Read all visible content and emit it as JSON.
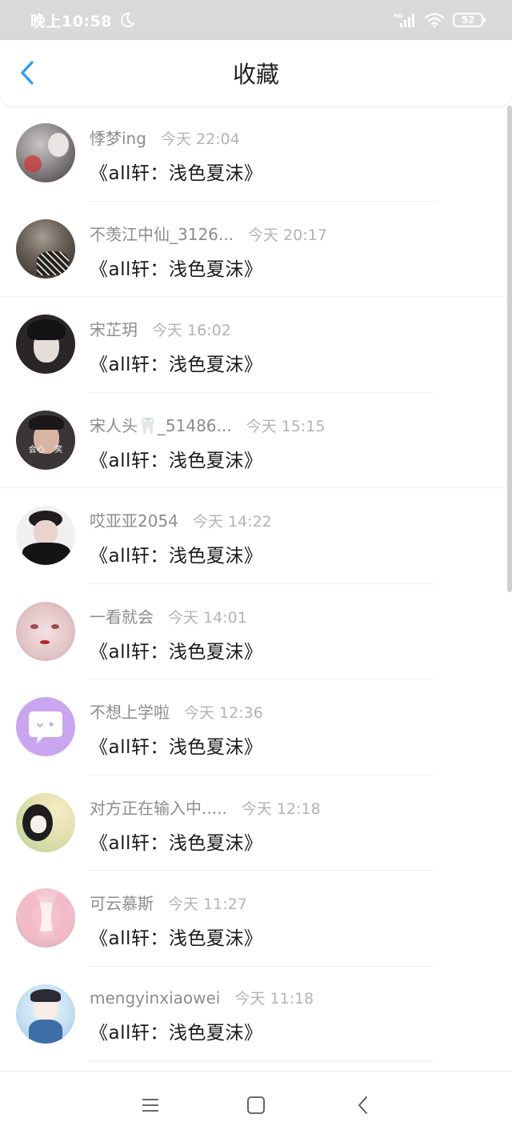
{
  "status_bar": {
    "time": "晚上10:58",
    "network": "HD",
    "battery": "52"
  },
  "header": {
    "title": "收藏"
  },
  "items": [
    {
      "name": "悸梦ing",
      "time": "今天 22:04",
      "title": "《all轩：浅色夏沫》"
    },
    {
      "name": "不羡江中仙_3126...",
      "time": "今天 20:17",
      "title": "《all轩：浅色夏沫》"
    },
    {
      "name": "宋芷玥",
      "time": "今天 16:02",
      "title": "《all轩：浅色夏沫》"
    },
    {
      "name": "宋人头🦷_51486...",
      "time": "今天 15:15",
      "title": "《all轩：浅色夏沫》",
      "avatar_text": "会心    笑"
    },
    {
      "name": "哎亚亚2054",
      "time": "今天 14:22",
      "title": "《all轩：浅色夏沫》"
    },
    {
      "name": "一看就会",
      "time": "今天 14:01",
      "title": "《all轩：浅色夏沫》"
    },
    {
      "name": "不想上学啦",
      "time": "今天 12:36",
      "title": "《all轩：浅色夏沫》"
    },
    {
      "name": "对方正在输入中.....",
      "time": "今天 12:18",
      "title": "《all轩：浅色夏沫》"
    },
    {
      "name": "可云慕斯",
      "time": "今天 11:27",
      "title": "《all轩：浅色夏沫》"
    },
    {
      "name": "mengyinxiaowei",
      "time": "今天 11:18",
      "title": "《all轩：浅色夏沫》"
    }
  ],
  "colors": {
    "accent": "#2a9df4",
    "status_bar_bg": "#d9d9d9"
  }
}
